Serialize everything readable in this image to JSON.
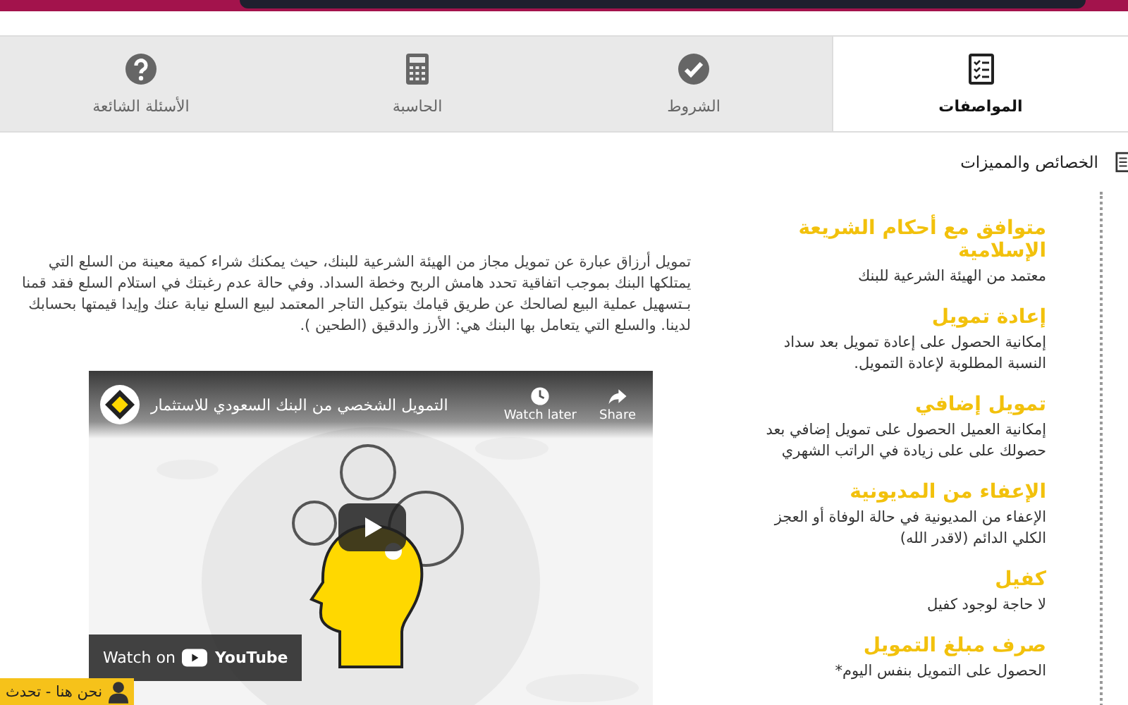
{
  "tabs": [
    {
      "label": "المواصفات",
      "kind": "specs",
      "selected": true
    },
    {
      "label": "الشروط",
      "kind": "terms",
      "selected": false
    },
    {
      "label": "الحاسبة",
      "kind": "calculator",
      "selected": false
    },
    {
      "label": "الأسئلة الشائعة",
      "kind": "faq",
      "selected": false
    }
  ],
  "section": {
    "title": "الخصائص والمميزات"
  },
  "features": [
    {
      "title": "متوافق مع أحكام الشريعة الإسلامية",
      "description": "معتمد من الهيئة الشرعية للبنك"
    },
    {
      "title": "إعادة تمويل",
      "description": "إمكانية الحصول على إعادة تمويل بعد سداد النسبة المطلوبة لإعادة التمويل."
    },
    {
      "title": "تمويل إضافي",
      "description": "إمكانية العميل الحصول على تمويل إضافي بعد حصولك على على زيادة في الراتب الشهري"
    },
    {
      "title": "الإعفاء من المديونية",
      "description": "الإعفاء من المديونية في حالة الوفاة أو العجز الكلي الدائم (لاقدر الله)"
    },
    {
      "title": "كفيل",
      "description": "لا حاجة لوجود كفيل"
    },
    {
      "title": "صرف مبلغ التمويل",
      "description": "الحصول على التمويل بنفس اليوم*"
    }
  ],
  "description": "تمويل أرزاق عبارة عن تمويل مجاز من الهيئة الشرعية للبنك، حيث يمكنك شراء كمية معينة من السلع التي يمتلكها البنك بموجب اتفاقية تحدد هامش الربح وخطة السداد. وفي حالة عدم رغبتك في استلام السلع فقد قمنا بـتسهيل عملية البيع لصالحك عن طريق قيامك بتوكيل التاجر المعتمد لبيع السلع نيابة عنك وإيدا قيمتها بحسابك لدينا. والسلع التي يتعامل بها البنك هي: الأرز والدقيق (الطحين ).",
  "video": {
    "title": "التمويل الشخصي من البنك السعودي للاستثمار",
    "watch_later": "Watch later",
    "share": "Share",
    "watch_on": "Watch on",
    "brand": "YouTube"
  },
  "chat": {
    "label": "نحن هنا - تحدث"
  }
}
